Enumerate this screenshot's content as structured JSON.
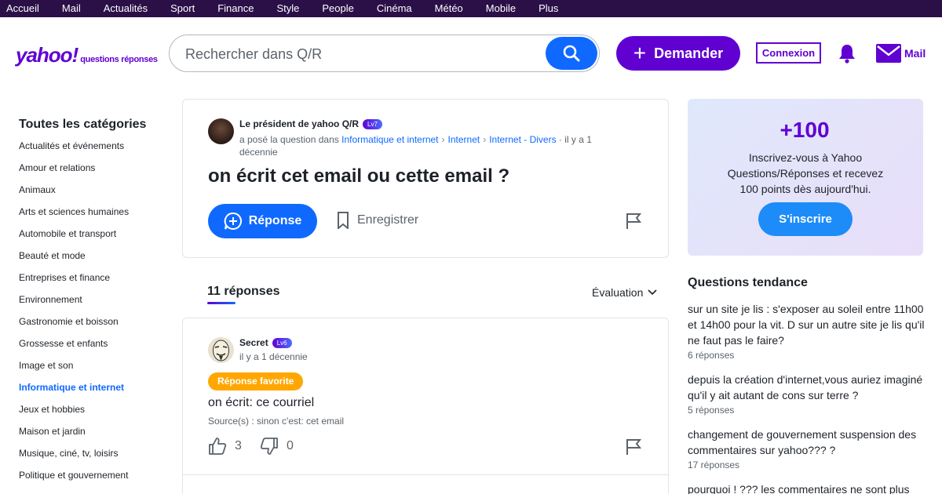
{
  "topnav": [
    "Accueil",
    "Mail",
    "Actualités",
    "Sport",
    "Finance",
    "Style",
    "People",
    "Cinéma",
    "Météo",
    "Mobile",
    "Plus"
  ],
  "header": {
    "logo_main": "yahoo!",
    "logo_sub": "questions réponses",
    "search_placeholder": "Rechercher dans Q/R",
    "ask_label": "Demander",
    "login_label": "Connexion",
    "mail_label": "Mail"
  },
  "sidebar": {
    "title": "Toutes les catégories",
    "items": [
      "Actualités et événements",
      "Amour et relations",
      "Animaux",
      "Arts et sciences humaines",
      "Automobile et transport",
      "Beauté et mode",
      "Entreprises et finance",
      "Environnement",
      "Gastronomie et boisson",
      "Grossesse et enfants",
      "Image et son",
      "Informatique et internet",
      "Jeux et hobbies",
      "Maison et jardin",
      "Musique, ciné, tv, loisirs",
      "Politique et gouvernement"
    ],
    "active_index": 11
  },
  "question": {
    "author": "Le président de yahoo Q/R",
    "level": "Lv7",
    "asked_prefix": "a posé la question dans",
    "crumbs": [
      "Informatique et internet",
      "Internet",
      "Internet - Divers"
    ],
    "time": "· il y a 1 décennie",
    "title": "on écrit cet email ou cette email ?",
    "answer_label": "Réponse",
    "save_label": "Enregistrer"
  },
  "answers": {
    "count_label": "11 réponses",
    "sort_label": "Évaluation"
  },
  "answer": {
    "author": "Secret",
    "level": "Lv6",
    "time": "il y a 1 décennie",
    "badge": "Réponse favorite",
    "text": "on écrit: ce courriel",
    "source": "Source(s) : sinon c'est: cet email",
    "likes": "3",
    "dislikes": "0"
  },
  "promo": {
    "points": "+100",
    "text": "Inscrivez-vous à Yahoo Questions/Réponses et recevez 100 points dès aujourd'hui.",
    "button": "S'inscrire"
  },
  "trending": {
    "title": "Questions tendance",
    "items": [
      {
        "text": "sur un site je lis : s'exposer au soleil entre 11h00 et 14h00 pour la vit. D sur un autre site je lis qu'il ne faut pas le faire?",
        "count": "6 réponses"
      },
      {
        "text": "depuis la création d'internet,vous auriez imaginé qu'il y ait autant de cons sur terre ?",
        "count": "5 réponses"
      },
      {
        "text": "changement de gouvernement suspension des commentaires sur yahoo??? ?",
        "count": "17 réponses"
      },
      {
        "text": "pourquoi ! ??? les commentaires ne sont plus",
        "count": ""
      }
    ]
  },
  "colors": {
    "brand_purple": "#6001d2",
    "nav_bg": "#2b1048",
    "primary_blue": "#0f69ff",
    "favorite_orange": "#ffa700"
  }
}
